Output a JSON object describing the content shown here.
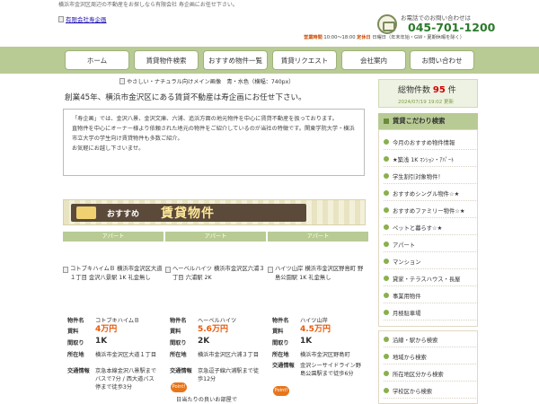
{
  "header": {
    "tagline": "横浜市金沢区周辺の不動産をお探しなら有限会社 寿企画にお任せ下さい。",
    "logo_alt": "有限会社寿企画",
    "phone_label": "お電話でのお問い合わせは",
    "phone_number": "045-701-1200",
    "hours_label": "営業時間",
    "hours_value": "10:00～18:00",
    "holiday_label": "定休日",
    "holiday_value": "日曜日（年末年始・GW・夏期休暇を除く）"
  },
  "nav": {
    "items": [
      {
        "label": "ホーム"
      },
      {
        "label": "賃貸物件検索"
      },
      {
        "label": "おすすめ物件一覧"
      },
      {
        "label": "賃貸リクエスト"
      },
      {
        "label": "会社案内"
      },
      {
        "label": "お問い合わせ"
      }
    ]
  },
  "main": {
    "hero_alt": "やさしい・ナチュラル向けメイン画像　青・水色（横幅：740px）",
    "lead": "創業45年、横浜市金沢区にある賃貸不動産は寿企画にお任せ下さい。",
    "intro": [
      "「寿企画」では、金沢八景、金沢文庫、六浦、追浜方面の地元物件を中心に賃貸不動産を扱っております。",
      "直物件を中心にオーナー様より依頼された地元の物件をご紹介しているのが当社の特徴です。関東学院大学・横浜市立大学の学生向け賃貸物件も多数ご紹介。",
      "お気軽にお越し下さいませ。"
    ],
    "banner": {
      "small": "おすすめ",
      "big": "賃貸物件"
    },
    "cards": [
      {
        "type": "アパート",
        "img_alt": "コトブキハイムＢ 横浜市金沢区大道１丁目 金沢八景駅 1K 礼金無し",
        "name_key": "物件名",
        "name": "コトブキハイムＢ",
        "rent_key": "賃料",
        "rent": "4万円",
        "layout_key": "間取り",
        "layout": "1K",
        "address_key": "所在地",
        "address": "横浜市金沢区大道１丁目",
        "access_key": "交通情報",
        "access": "京急本線金沢八景駅までバスで7分 / 西大道バス停まで徒歩3分"
      },
      {
        "type": "アパート",
        "img_alt": "ヘーベルハイツ 横浜市金沢区六浦３丁目 六浦駅 2K",
        "name_key": "物件名",
        "name": "ヘーベルハイツ",
        "rent_key": "賃料",
        "rent": "5.6万円",
        "layout_key": "間取り",
        "layout": "2K",
        "address_key": "所在地",
        "address": "横浜市金沢区六浦３丁目",
        "access_key": "交通情報",
        "access": "京急逗子線六浦駅まで徒歩12分",
        "point": "Point!",
        "point_text": "日当たりの良いお部屋で"
      },
      {
        "type": "アパート",
        "img_alt": "ハイツ山岸 横浜市金沢区野島町 野島公園駅 1K 礼金無し",
        "name_key": "物件名",
        "name": "ハイツ山岸",
        "rent_key": "賃料",
        "rent": "4.5万円",
        "layout_key": "間取り",
        "layout": "1K",
        "address_key": "所在地",
        "address": "横浜市金沢区野島町",
        "access_key": "交通情報",
        "access": "金沢シーサイドライン野島公園駅まで徒歩6分",
        "point": "Point!"
      }
    ]
  },
  "sidebar": {
    "count_label": "総物件数",
    "count_value": "95",
    "count_unit": "件",
    "count_date": "2024/07/19 19:02 更新",
    "head": "賃貸こだわり検索",
    "items": [
      "今月のおすすめ物件情報",
      "★築浅 1K ﾏﾝｼｮﾝ・ｱﾊﾟｰﾄ",
      "学生割引対象物件！",
      "おすすめシングル物件☆★",
      "おすすめファミリー物件☆★",
      "ペットと暮らす☆★",
      "アパート",
      "マンション",
      "貸家・テラスハウス・長屋",
      "事業用物件",
      "月極駐車場"
    ],
    "items2": [
      "沿線・駅から検索",
      "地域から検索",
      "所在地区分から検索",
      "学校区から検索"
    ]
  }
}
